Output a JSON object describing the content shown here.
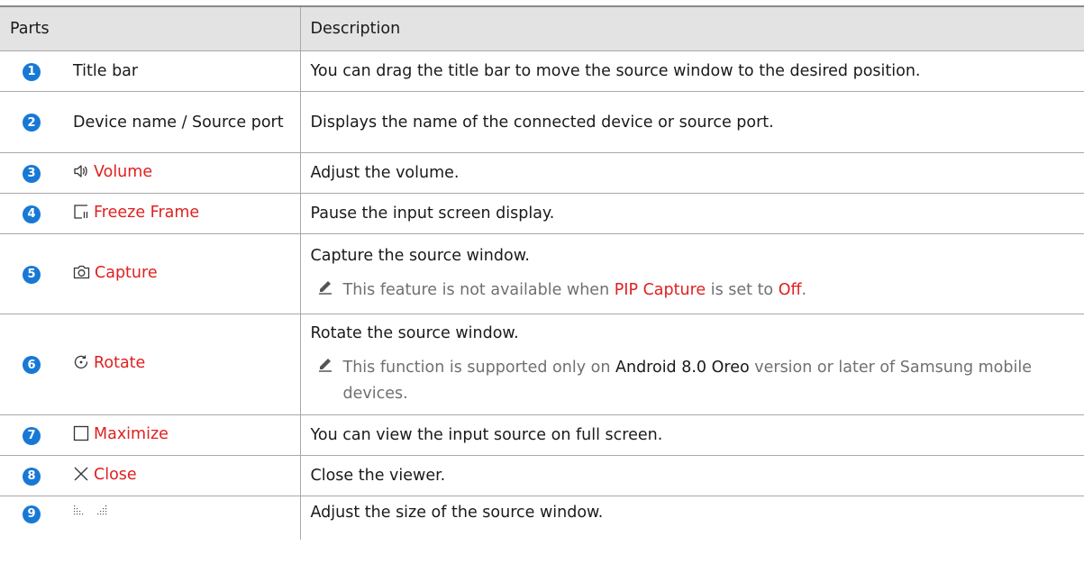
{
  "header": {
    "parts": "Parts",
    "description": "Description"
  },
  "rows": [
    {
      "num": "1",
      "part": "Title bar",
      "icon": "",
      "desc": "You can drag the title bar to move the source window to the desired position."
    },
    {
      "num": "2",
      "part": "Device name / Source port",
      "icon": "",
      "desc": "Displays the name of the connected device or source port."
    },
    {
      "num": "3",
      "part": "Volume",
      "icon": "speaker-icon",
      "desc": "Adjust the volume."
    },
    {
      "num": "4",
      "part": "Freeze Frame",
      "icon": "freeze-frame-icon",
      "desc": "Pause the input screen display."
    },
    {
      "num": "5",
      "part": "Capture",
      "icon": "camera-icon",
      "desc": "Capture the source window.",
      "note": {
        "pre": "This feature is not available when ",
        "hl1": "PIP Capture",
        "mid": " is set to ",
        "hl2": "Off",
        "post": "."
      }
    },
    {
      "num": "6",
      "part": "Rotate",
      "icon": "rotate-icon",
      "desc": "Rotate the source window.",
      "note": {
        "pre": "This function is supported only on ",
        "bold": "Android 8.0 Oreo",
        "post": " version or later of Samsung mobile devices."
      }
    },
    {
      "num": "7",
      "part": "Maximize",
      "icon": "maximize-icon",
      "desc": "You can view the input source on full screen."
    },
    {
      "num": "8",
      "part": "Close",
      "icon": "close-icon",
      "desc": "Close the viewer."
    },
    {
      "num": "9",
      "part": "",
      "icon": "resize-handle-icon",
      "desc": "Adjust the size of the source window."
    }
  ],
  "colors": {
    "badge": "#1878d6",
    "highlight": "#e02020",
    "header_bg": "#e3e3e3"
  }
}
